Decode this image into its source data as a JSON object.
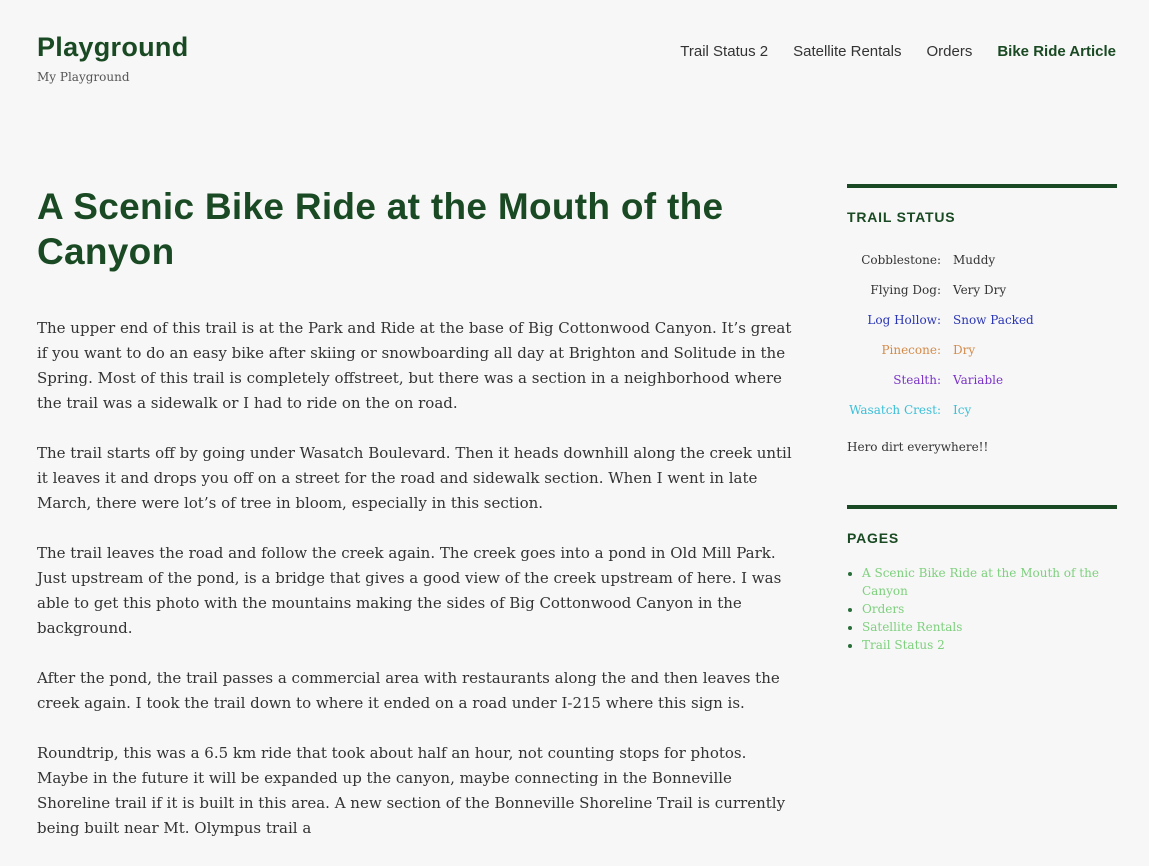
{
  "site": {
    "title": "Playground",
    "description": "My Playground"
  },
  "nav": {
    "items": [
      {
        "label": "Trail Status 2",
        "current": false
      },
      {
        "label": "Satellite Rentals",
        "current": false
      },
      {
        "label": "Orders",
        "current": false
      },
      {
        "label": "Bike Ride Article",
        "current": true
      }
    ]
  },
  "article": {
    "title": "A Scenic Bike Ride at the Mouth of the Canyon",
    "paragraphs": [
      "The upper end of this trail is at the Park and Ride at the base of Big Cottonwood Canyon. It’s great if you want to do an easy bike after skiing or snowboarding all day at Brighton and Solitude in the Spring. Most of this trail is completely offstreet, but there was a section in a neighborhood where the trail was a sidewalk or I had to ride on the on road.",
      "The trail starts off by going under Wasatch Boulevard. Then it heads downhill along the creek until it leaves it and drops you off on a street for the road and sidewalk section. When I went in late March, there were lot’s of tree in bloom, especially in this section.",
      "The trail leaves the road and follow the creek again. The creek goes into a pond in Old Mill Park. Just upstream of the pond, is a bridge that gives a good view of the creek upstream of here. I was able to get this photo with the mountains making the sides of Big Cottonwood Canyon in the background.",
      "After the pond, the trail passes a commercial area with restaurants along the and then leaves the creek again. I took the trail down to where it ended on a road under I-215 where this sign is.",
      "Roundtrip, this was a 6.5 km ride that took about half an hour, not counting stops for photos. Maybe in the future it will be expanded up the canyon, maybe connecting in the Bonneville Shoreline trail if it is built in this area. A new section of the Bonneville Shoreline Trail is currently being built near Mt. Olympus trail a"
    ]
  },
  "trail_status": {
    "title": "TRAIL STATUS",
    "rows": [
      {
        "trail": "Cobblestone:",
        "status": "Muddy",
        "color": "#333333"
      },
      {
        "trail": "Flying Dog:",
        "status": "Very Dry",
        "color": "#333333"
      },
      {
        "trail": "Log Hollow:",
        "status": "Snow Packed",
        "color": "#2a35b5"
      },
      {
        "trail": "Pinecone:",
        "status": "Dry",
        "color": "#d48b4a"
      },
      {
        "trail": "Stealth:",
        "status": "Variable",
        "color": "#7a35c8"
      },
      {
        "trail": "Wasatch Crest:",
        "status": "Icy",
        "color": "#3bbfd8"
      }
    ],
    "note": "Hero dirt everywhere!!"
  },
  "pages": {
    "title": "PAGES",
    "items": [
      "A Scenic Bike Ride at the Mouth of the Canyon",
      "Orders",
      "Satellite Rentals",
      "Trail Status 2"
    ]
  },
  "colors": {
    "brand": "#1a4a23",
    "page_link": "#7ed07e",
    "background": "#f7f7f7"
  }
}
